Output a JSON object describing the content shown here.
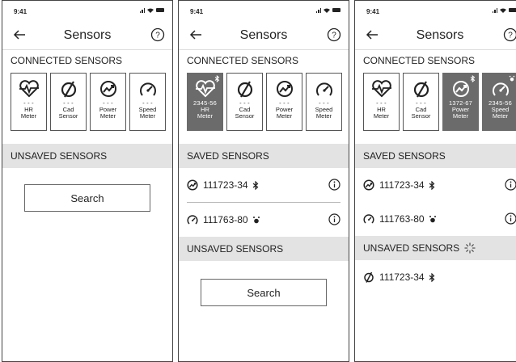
{
  "screens": [
    {
      "status_time": "9:41",
      "title": "Sensors",
      "connected_header": "CONNECTED SENSORS",
      "tiles": [
        {
          "id": "- - -",
          "label1": "HR",
          "label2": "Meter",
          "icon": "heart-pulse-icon",
          "active": false
        },
        {
          "id": "- - -",
          "label1": "Cad",
          "label2": "Sensor",
          "icon": "cadence-icon",
          "active": false
        },
        {
          "id": "- - -",
          "label1": "Power",
          "label2": "Meter",
          "icon": "power-icon",
          "active": false
        },
        {
          "id": "- - -",
          "label1": "Speed",
          "label2": "Meter",
          "icon": "speedometer-icon",
          "active": false
        }
      ],
      "unsaved_header": "UNSAVED SENSORS",
      "search_label": "Search"
    },
    {
      "status_time": "9:41",
      "title": "Sensors",
      "connected_header": "CONNECTED SENSORS",
      "tiles": [
        {
          "id": "2345-56",
          "label1": "HR",
          "label2": "Meter",
          "icon": "heart-pulse-icon",
          "active": true
        },
        {
          "id": "- - -",
          "label1": "Cad",
          "label2": "Sensor",
          "icon": "cadence-icon",
          "active": false
        },
        {
          "id": "- - -",
          "label1": "Power",
          "label2": "Meter",
          "icon": "power-icon",
          "active": false
        },
        {
          "id": "- - -",
          "label1": "Speed",
          "label2": "Meter",
          "icon": "speedometer-icon",
          "active": false
        }
      ],
      "saved_header": "SAVED SENSORS",
      "saved": [
        {
          "id": "111723-34",
          "icon": "power-icon",
          "conn": "bluetooth-icon"
        },
        {
          "id": "111763-80",
          "icon": "speedometer-icon",
          "conn": "ant-icon"
        }
      ],
      "unsaved_header": "UNSAVED SENSORS",
      "search_label": "Search"
    },
    {
      "status_time": "9:41",
      "title": "Sensors",
      "connected_header": "CONNECTED SENSORS",
      "tiles": [
        {
          "id": "- - -",
          "label1": "HR",
          "label2": "Meter",
          "icon": "heart-pulse-icon",
          "active": false
        },
        {
          "id": "- - -",
          "label1": "Cad",
          "label2": "Sensor",
          "icon": "cadence-icon",
          "active": false
        },
        {
          "id": "1372-67",
          "label1": "Power",
          "label2": "Meter",
          "icon": "power-icon",
          "active": true
        },
        {
          "id": "2345-56",
          "label1": "Speed",
          "label2": "Meter",
          "icon": "speedometer-icon",
          "active": true
        }
      ],
      "saved_header": "SAVED SENSORS",
      "saved": [
        {
          "id": "111723-34",
          "icon": "power-icon",
          "conn": "bluetooth-icon"
        },
        {
          "id": "111763-80",
          "icon": "speedometer-icon",
          "conn": "ant-icon"
        }
      ],
      "unsaved_header": "UNSAVED SENSORS",
      "unsaved": [
        {
          "id": "111723-34",
          "icon": "cadence-icon",
          "conn": "bluetooth-icon"
        }
      ]
    }
  ]
}
